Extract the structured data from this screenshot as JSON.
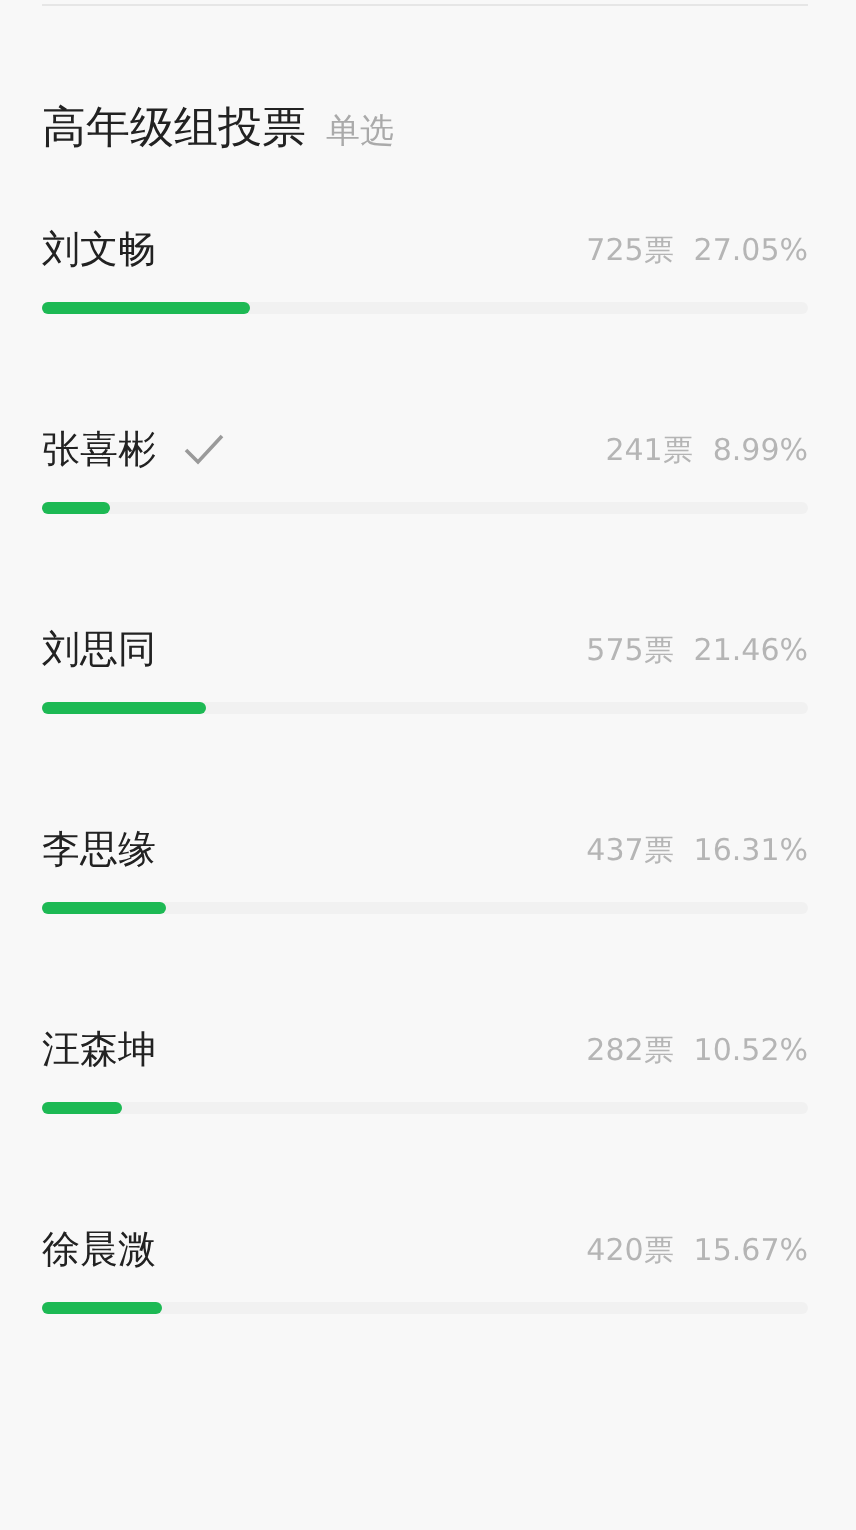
{
  "poll": {
    "title": "高年级组投票",
    "mode": "单选",
    "options": [
      {
        "name": "刘文畅",
        "voted": false,
        "votes": "725票",
        "percent": "27.05%",
        "level": 0.2705
      },
      {
        "name": "张喜彬",
        "voted": true,
        "votes": "241票",
        "percent": "8.99%",
        "level": 0.0899
      },
      {
        "name": "刘思同",
        "voted": false,
        "votes": "575票",
        "percent": "21.46%",
        "level": 0.2146
      },
      {
        "name": "李思缘",
        "voted": false,
        "votes": "437票",
        "percent": "16.31%",
        "level": 0.1631
      },
      {
        "name": "汪森坤",
        "voted": false,
        "votes": "282票",
        "percent": "10.52%",
        "level": 0.1052
      },
      {
        "name": "徐晨溦",
        "voted": false,
        "votes": "420票",
        "percent": "15.67%",
        "level": 0.1567
      }
    ]
  }
}
